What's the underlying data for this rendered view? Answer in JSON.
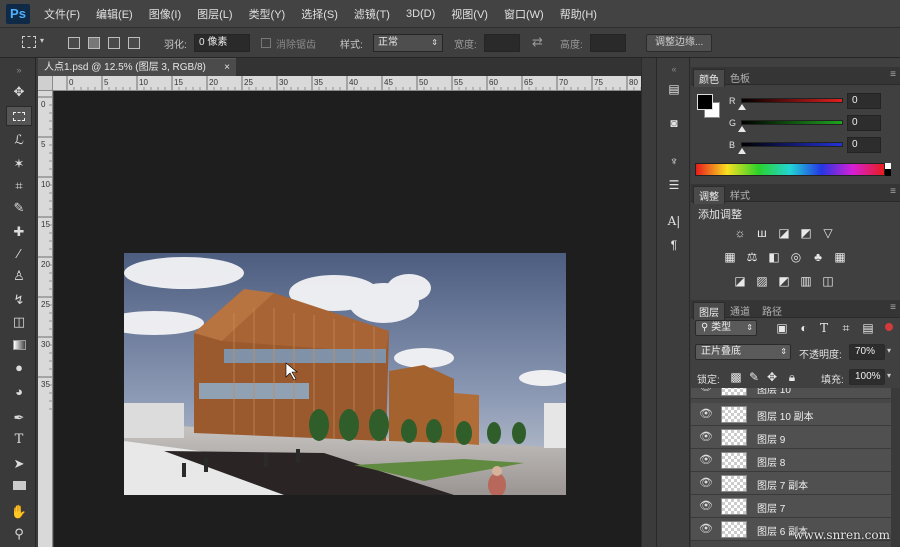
{
  "app": {
    "logo": "Ps"
  },
  "menu": [
    "文件(F)",
    "编辑(E)",
    "图像(I)",
    "图层(L)",
    "类型(Y)",
    "选择(S)",
    "滤镜(T)",
    "3D(D)",
    "视图(V)",
    "窗口(W)",
    "帮助(H)"
  ],
  "options": {
    "feather_label": "羽化:",
    "feather_value": "0 像素",
    "antialias_label": "消除锯齿",
    "style_label": "样式:",
    "style_value": "正常",
    "width_label": "宽度:",
    "height_label": "高度:",
    "refine_edge": "调整边缘..."
  },
  "document": {
    "tab_title": "人点1.psd @ 12.5% (图层 3, RGB/8)",
    "close": "×"
  },
  "ruler": {
    "h_ticks": [
      "0",
      "5",
      "10",
      "15",
      "20",
      "25",
      "30",
      "35",
      "40",
      "45",
      "50",
      "55",
      "60",
      "65",
      "70",
      "75",
      "80"
    ],
    "v_ticks": [
      "0",
      "5",
      "10",
      "15",
      "20",
      "25",
      "30",
      "35"
    ]
  },
  "color_panel": {
    "tabs": [
      "颜色",
      "色板"
    ],
    "channels": [
      {
        "label": "R",
        "value": "0",
        "color": "#e01f1f"
      },
      {
        "label": "G",
        "value": "0",
        "color": "#1fa31f"
      },
      {
        "label": "B",
        "value": "0",
        "color": "#2233d8"
      }
    ]
  },
  "adjust_panel": {
    "tabs": [
      "调整",
      "样式"
    ],
    "title": "添加调整",
    "icons": [
      "brightness-icon",
      "levels-icon",
      "curves-icon",
      "exposure-icon",
      "vibrance-icon",
      "hue-icon",
      "color-balance-icon",
      "bw-icon",
      "photo-filter-icon",
      "channel-mixer-icon",
      "color-lookup-icon",
      "invert-icon",
      "posterize-icon",
      "threshold-icon",
      "gradient-map-icon",
      "selective-color-icon"
    ]
  },
  "layers_panel": {
    "tabs": [
      "图层",
      "通道",
      "路径"
    ],
    "filter_label": "类型",
    "blend_mode": "正片叠底",
    "opacity_label": "不透明度:",
    "opacity_value": "70%",
    "lock_label": "锁定:",
    "fill_label": "填充:",
    "fill_value": "100%",
    "layers": [
      {
        "name": "图层 10"
      },
      {
        "name": "图层 10 副本"
      },
      {
        "name": "图层 9"
      },
      {
        "name": "图层 8"
      },
      {
        "name": "图层 7 副本"
      },
      {
        "name": "图层 7"
      },
      {
        "name": "图层 6 副本"
      }
    ]
  },
  "watermark": "www.snren.com"
}
